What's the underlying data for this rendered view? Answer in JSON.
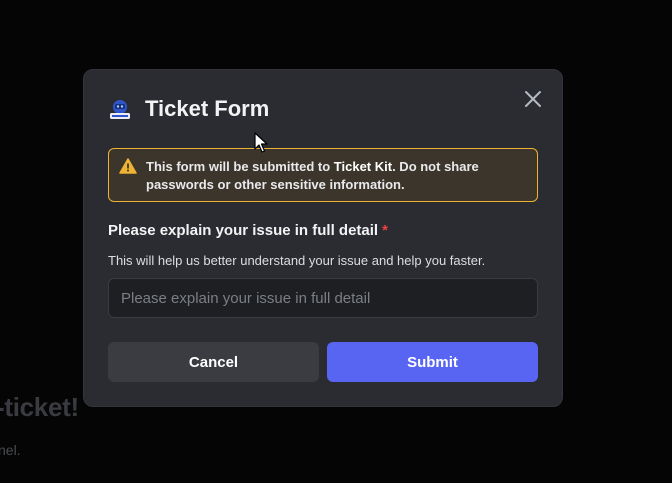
{
  "background": {
    "heading": "-ticket!",
    "subtext": "nel."
  },
  "modal": {
    "title": "Ticket Form",
    "logo_icon": "ticket-kit-logo",
    "close_icon": "close-icon",
    "warning": {
      "icon": "warning-icon",
      "text_before": "This form will be submitted to ",
      "brand": "Ticket Kit",
      "text_after": ". Do not share passwords or other sensitive information."
    },
    "field": {
      "label": "Please explain your issue in full detail",
      "required_mark": "*",
      "hint": "This will help us better understand your issue and help you faster.",
      "placeholder": "Please explain your issue in full detail",
      "value": ""
    },
    "buttons": {
      "cancel": "Cancel",
      "submit": "Submit"
    }
  },
  "colors": {
    "modal_bg": "#2b2c31",
    "warning_border": "#f0b232",
    "submit": "#5865f2",
    "required": "#f23f43"
  }
}
